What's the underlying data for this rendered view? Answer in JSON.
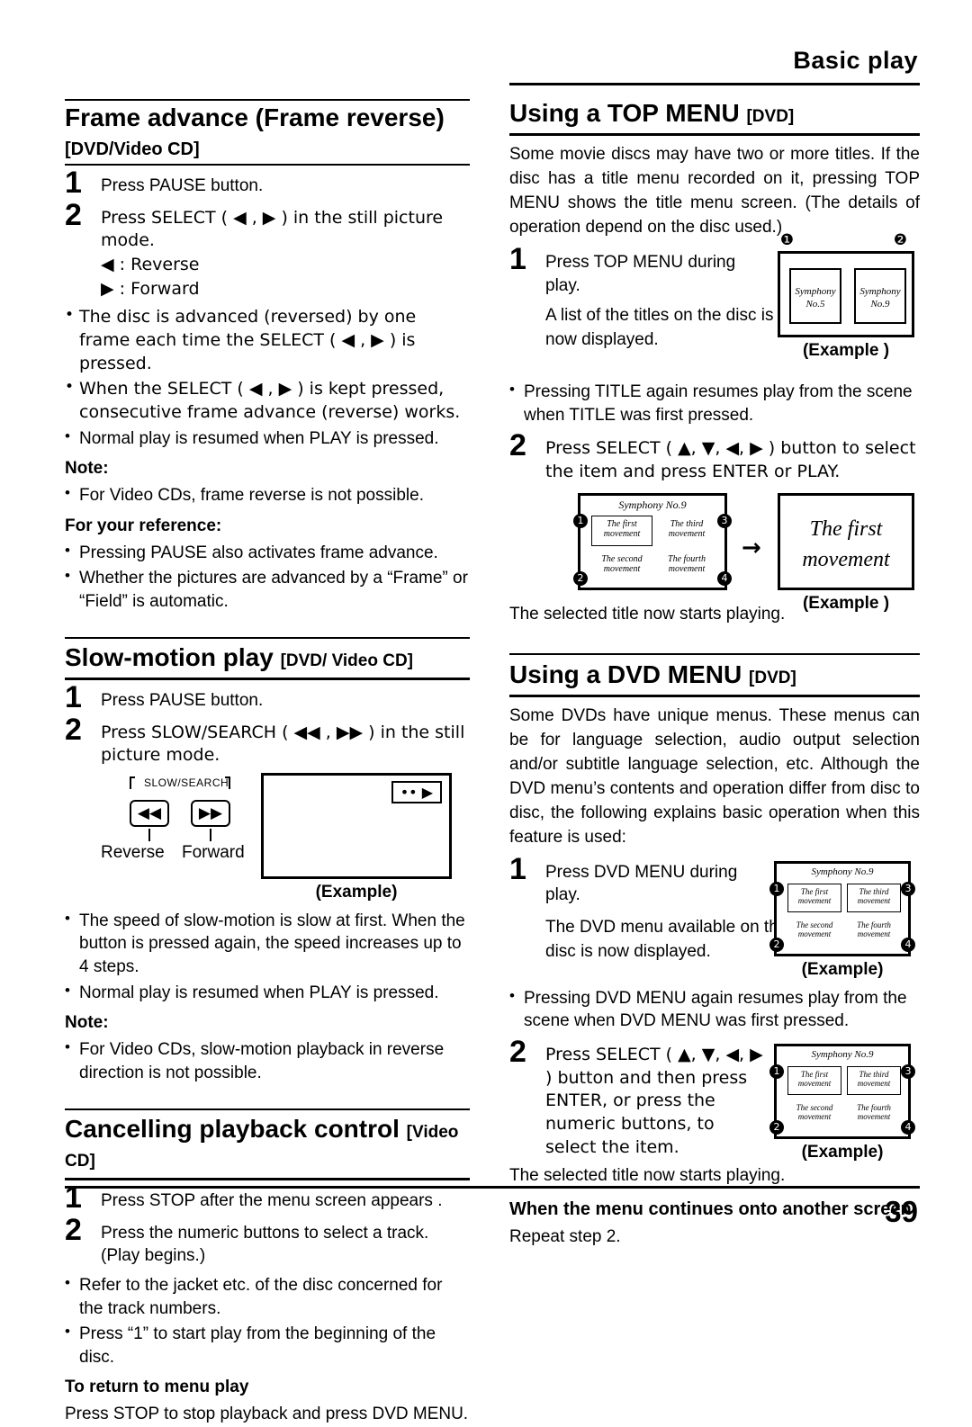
{
  "header": {
    "title": "Basic play"
  },
  "page_number": "39",
  "left": {
    "frame_advance": {
      "title": "Frame advance (Frame reverse)",
      "subtitle": "[DVD/Video CD]",
      "steps": [
        {
          "num": "1",
          "text": "Press PAUSE button."
        },
        {
          "num": "2",
          "text": "Press SELECT ( ◀ , ▶ ) in the still picture mode."
        }
      ],
      "sub_lines": [
        "◀ : Reverse",
        "▶ : Forward"
      ],
      "bullets": [
        "The disc is advanced (reversed) by one frame each time the SELECT ( ◀ , ▶ ) is pressed.",
        "When the SELECT ( ◀ , ▶ ) is kept pressed, consecutive frame advance (reverse) works.",
        "Normal play is resumed when PLAY is pressed."
      ],
      "note_heading": "Note:",
      "note_bullets": [
        "For Video CDs, frame reverse is not possible."
      ],
      "reference_heading": "For your reference:",
      "reference_bullets": [
        "Pressing PAUSE also activates frame advance.",
        "Whether the pictures are advanced by a “Frame” or “Field” is automatic."
      ]
    },
    "slow_motion": {
      "title": "Slow-motion play",
      "tag": "[DVD/ Video CD]",
      "steps": [
        {
          "num": "1",
          "text": "Press PAUSE button."
        },
        {
          "num": "2",
          "text": "Press SLOW/SEARCH ( ◀◀ , ▶▶ ) in the still picture mode."
        }
      ],
      "illustration": {
        "bracket_label": "SLOW/SEARCH",
        "left_icon": "◀◀",
        "right_icon": "▶▶",
        "left_label": "Reverse",
        "right_label": "Forward",
        "screen_icon": "•• ▶",
        "caption": "(Example)"
      },
      "bullets": [
        "The speed of slow-motion is slow at first. When the button is pressed again, the speed increases up to 4 steps.",
        "Normal play is resumed when PLAY is pressed."
      ],
      "note_heading": "Note:",
      "note_bullets": [
        "For Video CDs, slow-motion playback in reverse direction is not possible."
      ]
    },
    "cancelling": {
      "title": "Cancelling playback control",
      "tag": "[Video CD]",
      "steps": [
        {
          "num": "1",
          "text": "Press STOP after the menu screen appears ."
        },
        {
          "num": "2",
          "text": "Press the numeric buttons to select a track."
        }
      ],
      "step2_sub": "(Play begins.)",
      "bullets": [
        "Refer to the jacket etc. of the disc concerned for the track numbers.",
        "Press “1” to start play from the beginning of the disc."
      ],
      "return_heading": "To return to menu play",
      "return_text": "Press STOP to stop playback and press DVD MENU."
    }
  },
  "right": {
    "top_menu": {
      "title": "Using a TOP MENU",
      "tag": "[DVD]",
      "intro": "Some movie discs may have two or more titles. If the disc has a title menu recorded on it, pressing TOP MENU shows the title menu screen. (The details of operation depend on the disc used.)",
      "step1": {
        "num": "1",
        "text": "Press TOP MENU during play."
      },
      "step1_lines": [
        "A list of the titles on the disc is",
        "now displayed."
      ],
      "screen1": {
        "item_left_line1": "Symphony",
        "item_left_line2": "No.5",
        "item_right_line1": "Symphony",
        "item_right_line2": "No.9",
        "marker_1": "❶",
        "marker_2": "❷",
        "caption": "(Example )"
      },
      "bullet": "Pressing TITLE again resumes play from the scene when TITLE was first pressed.",
      "step2": {
        "num": "2",
        "text": "Press SELECT ( ▲, ▼, ◀, ▶ ) button to select the item and press ENTER or PLAY."
      },
      "screen2": {
        "heading": "Symphony  No.9",
        "cells": [
          {
            "marker": "1",
            "line1": "The first",
            "line2": "movement"
          },
          {
            "marker": "3",
            "line1": "The third",
            "line2": "movement"
          },
          {
            "marker": "2",
            "line1": "The second",
            "line2": "movement"
          },
          {
            "marker": "4",
            "line1": "The fourth",
            "line2": "movement"
          }
        ],
        "arrow": "→",
        "result_line1": "The first",
        "result_line2": "movement",
        "caption": "(Example )"
      },
      "closing": "The selected title now starts playing."
    },
    "dvd_menu": {
      "title": "Using a DVD MENU",
      "tag": "[DVD]",
      "intro": "Some DVDs have unique menus. These menus can be for language selection, audio output selection and/or subtitle language selection, etc. Although the DVD menu’s contents and operation differ from disc to disc, the following explains basic operation when this feature is used:",
      "step1": {
        "num": "1",
        "text": "Press DVD MENU during play."
      },
      "step1_lines": [
        "The DVD menu available on the",
        "disc is now displayed."
      ],
      "screen1": {
        "heading": "Symphony   No.9",
        "cells": [
          {
            "marker": "1",
            "line1": "The first",
            "line2": "movement"
          },
          {
            "marker": "3",
            "line1": "The third",
            "line2": "movement"
          },
          {
            "marker": "2",
            "line1": "The second",
            "line2": "movement"
          },
          {
            "marker": "4",
            "line1": "The fourth",
            "line2": "movement"
          }
        ],
        "caption": "(Example)"
      },
      "bullet": "Pressing DVD MENU again resumes play from the scene when DVD MENU was first pressed.",
      "step2": {
        "num": "2",
        "text": "Press SELECT ( ▲, ▼, ◀, ▶ ) button and then press ENTER, or press the numeric buttons, to select the item."
      },
      "screen2": {
        "heading": "Symphony   No.9",
        "cells": [
          {
            "marker": "1",
            "line1": "The first",
            "line2": "movement"
          },
          {
            "marker": "3",
            "line1": "The third",
            "line2": "movement"
          },
          {
            "marker": "2",
            "line1": "The second",
            "line2": "movement"
          },
          {
            "marker": "4",
            "line1": "The fourth",
            "line2": "movement"
          }
        ],
        "caption": "(Example)"
      },
      "closing": "The selected title now starts playing.",
      "continue_heading": "When the menu continues onto another screen",
      "continue_text": "Repeat step 2."
    }
  }
}
